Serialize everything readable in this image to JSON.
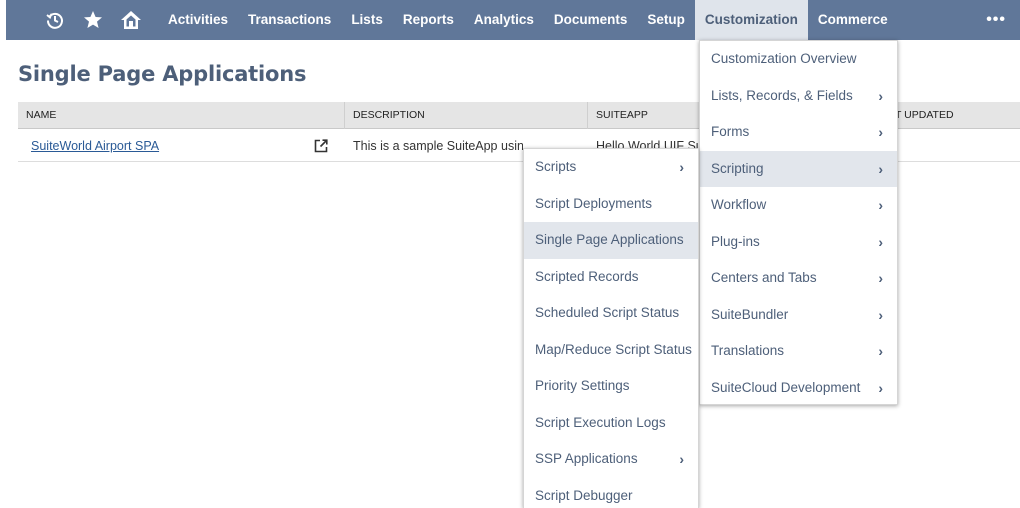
{
  "nav": {
    "icons": [
      "recent-history-icon",
      "star-icon",
      "home-icon"
    ],
    "items": [
      "Activities",
      "Transactions",
      "Lists",
      "Reports",
      "Analytics",
      "Documents",
      "Setup",
      "Customization",
      "Commerce"
    ],
    "active": "Customization",
    "more": "•••"
  },
  "page": {
    "title": "Single Page Applications"
  },
  "table": {
    "headers": [
      "NAME",
      "DESCRIPTION",
      "SUITEAPP",
      "ST UPDATED"
    ],
    "rows": [
      {
        "name": "SuiteWorld Airport SPA",
        "description": "This is a sample SuiteApp using the UIF",
        "suiteapp": "Hello World UIF Su"
      }
    ]
  },
  "customization_menu": [
    {
      "label": "Customization Overview",
      "submenu": false
    },
    {
      "label": "Lists, Records, & Fields",
      "submenu": true
    },
    {
      "label": "Forms",
      "submenu": true
    },
    {
      "label": "Scripting",
      "submenu": true,
      "highlighted": true
    },
    {
      "label": "Workflow",
      "submenu": true
    },
    {
      "label": "Plug-ins",
      "submenu": true
    },
    {
      "label": "Centers and Tabs",
      "submenu": true
    },
    {
      "label": "SuiteBundler",
      "submenu": true
    },
    {
      "label": "Translations",
      "submenu": true
    },
    {
      "label": "SuiteCloud Development",
      "submenu": true
    }
  ],
  "scripting_menu": [
    {
      "label": "Scripts",
      "submenu": true
    },
    {
      "label": "Script Deployments",
      "submenu": false
    },
    {
      "label": "Single Page Applications",
      "submenu": false,
      "highlighted": true
    },
    {
      "label": "Scripted Records",
      "submenu": false
    },
    {
      "label": "Scheduled Script Status",
      "submenu": false
    },
    {
      "label": "Map/Reduce Script Status",
      "submenu": false
    },
    {
      "label": "Priority Settings",
      "submenu": false
    },
    {
      "label": "Script Execution Logs",
      "submenu": false
    },
    {
      "label": "SSP Applications",
      "submenu": true
    },
    {
      "label": "Script Debugger",
      "submenu": false
    }
  ],
  "colors": {
    "nav_bg": "#607799",
    "accent_text": "#4d5f79",
    "link": "#2a5a96",
    "highlight": "#e2e6ec"
  }
}
